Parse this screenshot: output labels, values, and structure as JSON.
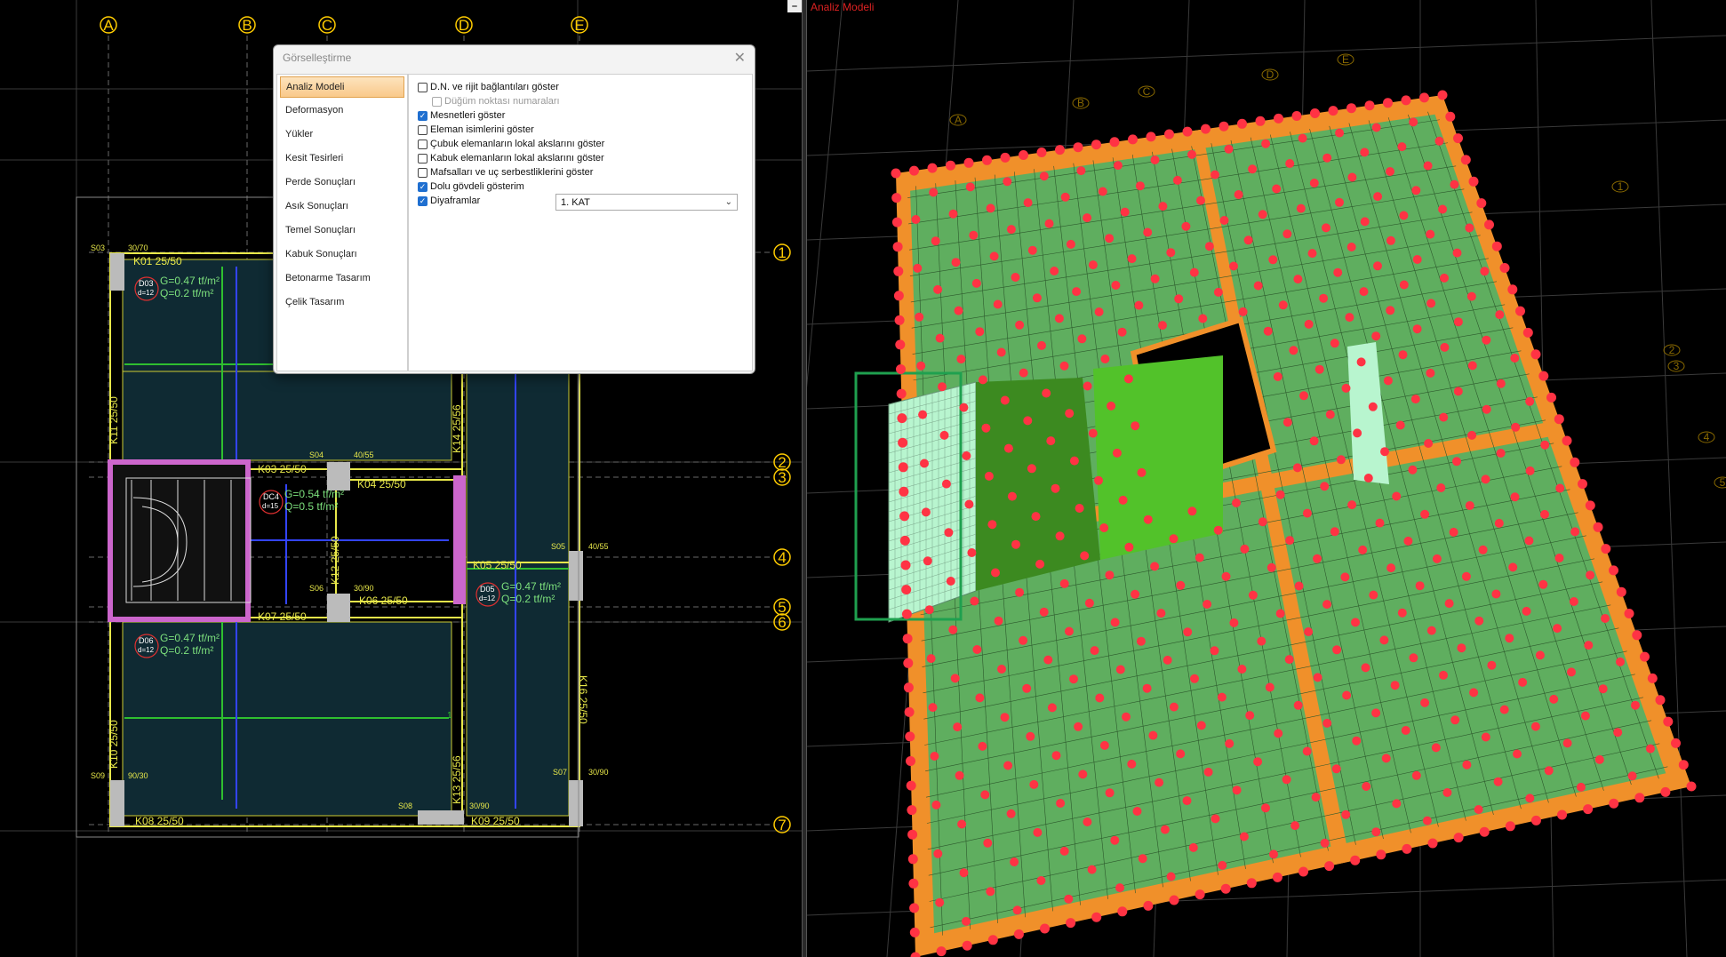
{
  "left_view": {
    "axes_top": [
      "A",
      "B",
      "C",
      "D",
      "E"
    ],
    "axes_right": [
      "1",
      "2",
      "3",
      "4",
      "5",
      "6",
      "7"
    ],
    "beams": [
      "K01 25/50",
      "K03 25/50",
      "K04 25/50",
      "K05 25/50",
      "K06 25/50",
      "K07 25/50",
      "K08 25/50",
      "K09 25/50",
      "K10 25/50",
      "K11 25/50",
      "K12 25/50",
      "K13 25/56",
      "K14 25/56",
      "K16 25/50"
    ],
    "columns": [
      "S03",
      "S04",
      "S05",
      "S06",
      "S07",
      "S08",
      "S09"
    ],
    "column_sizes": [
      "30/70",
      "40/55",
      "40/55",
      "30/90",
      "30/90",
      "30/90",
      "90/30"
    ],
    "slabs": [
      {
        "id": "D03",
        "d": "d=12",
        "g": "G=0.47 tf/m²",
        "q": "Q=0.2 tf/m²"
      },
      {
        "id": "DC4",
        "d": "d=15",
        "g": "G=0.54 tf/m²",
        "q": "Q=0.5 tf/m²"
      },
      {
        "id": "D05",
        "d": "d=12",
        "g": "G=0.47 tf/m²",
        "q": "Q=0.2 tf/m²"
      },
      {
        "id": "D06",
        "d": "d=12",
        "g": "G=0.47 tf/m²",
        "q": "Q=0.2 tf/m²"
      }
    ],
    "small_label": "1"
  },
  "dialog": {
    "title": "Görselleştirme",
    "close": "✕",
    "nav": [
      "Analiz Modeli",
      "Deformasyon",
      "Yükler",
      "Kesit Tesirleri",
      "Perde Sonuçları",
      "Asık Sonuçları",
      "Temel Sonuçları",
      "Kabuk Sonuçları",
      "Betonarme Tasarım",
      "Çelik Tasarım"
    ],
    "active_nav": 0,
    "options": [
      {
        "label": "D.N. ve rijit bağlantıları göster",
        "checked": false,
        "disabled": false,
        "indent": false
      },
      {
        "label": "Düğüm noktası numaraları",
        "checked": false,
        "disabled": true,
        "indent": true
      },
      {
        "label": "Mesnetleri göster",
        "checked": true,
        "disabled": false,
        "indent": false
      },
      {
        "label": "Eleman isimlerini göster",
        "checked": false,
        "disabled": false,
        "indent": false
      },
      {
        "label": "Çubuk elemanların lokal akslarını göster",
        "checked": false,
        "disabled": false,
        "indent": false
      },
      {
        "label": "Kabuk elemanların lokal akslarını göster",
        "checked": false,
        "disabled": false,
        "indent": false
      },
      {
        "label": "Mafsalları ve uç serbestliklerini göster",
        "checked": false,
        "disabled": false,
        "indent": false
      },
      {
        "label": "Dolu gövdeli gösterim",
        "checked": true,
        "disabled": false,
        "indent": false
      },
      {
        "label": "Diyaframlar",
        "checked": true,
        "disabled": false,
        "indent": false
      }
    ],
    "diaphragm_select": "1. KAT"
  },
  "right_view": {
    "title": "Analiz Modeli",
    "axes": [
      "A",
      "B",
      "C",
      "D",
      "E",
      "1",
      "2",
      "3",
      "4",
      "5"
    ],
    "colors": {
      "slab": "#5fae5f",
      "beam": "#f0902a",
      "support": "#ff3344",
      "wall": "#b8f5cf"
    }
  }
}
